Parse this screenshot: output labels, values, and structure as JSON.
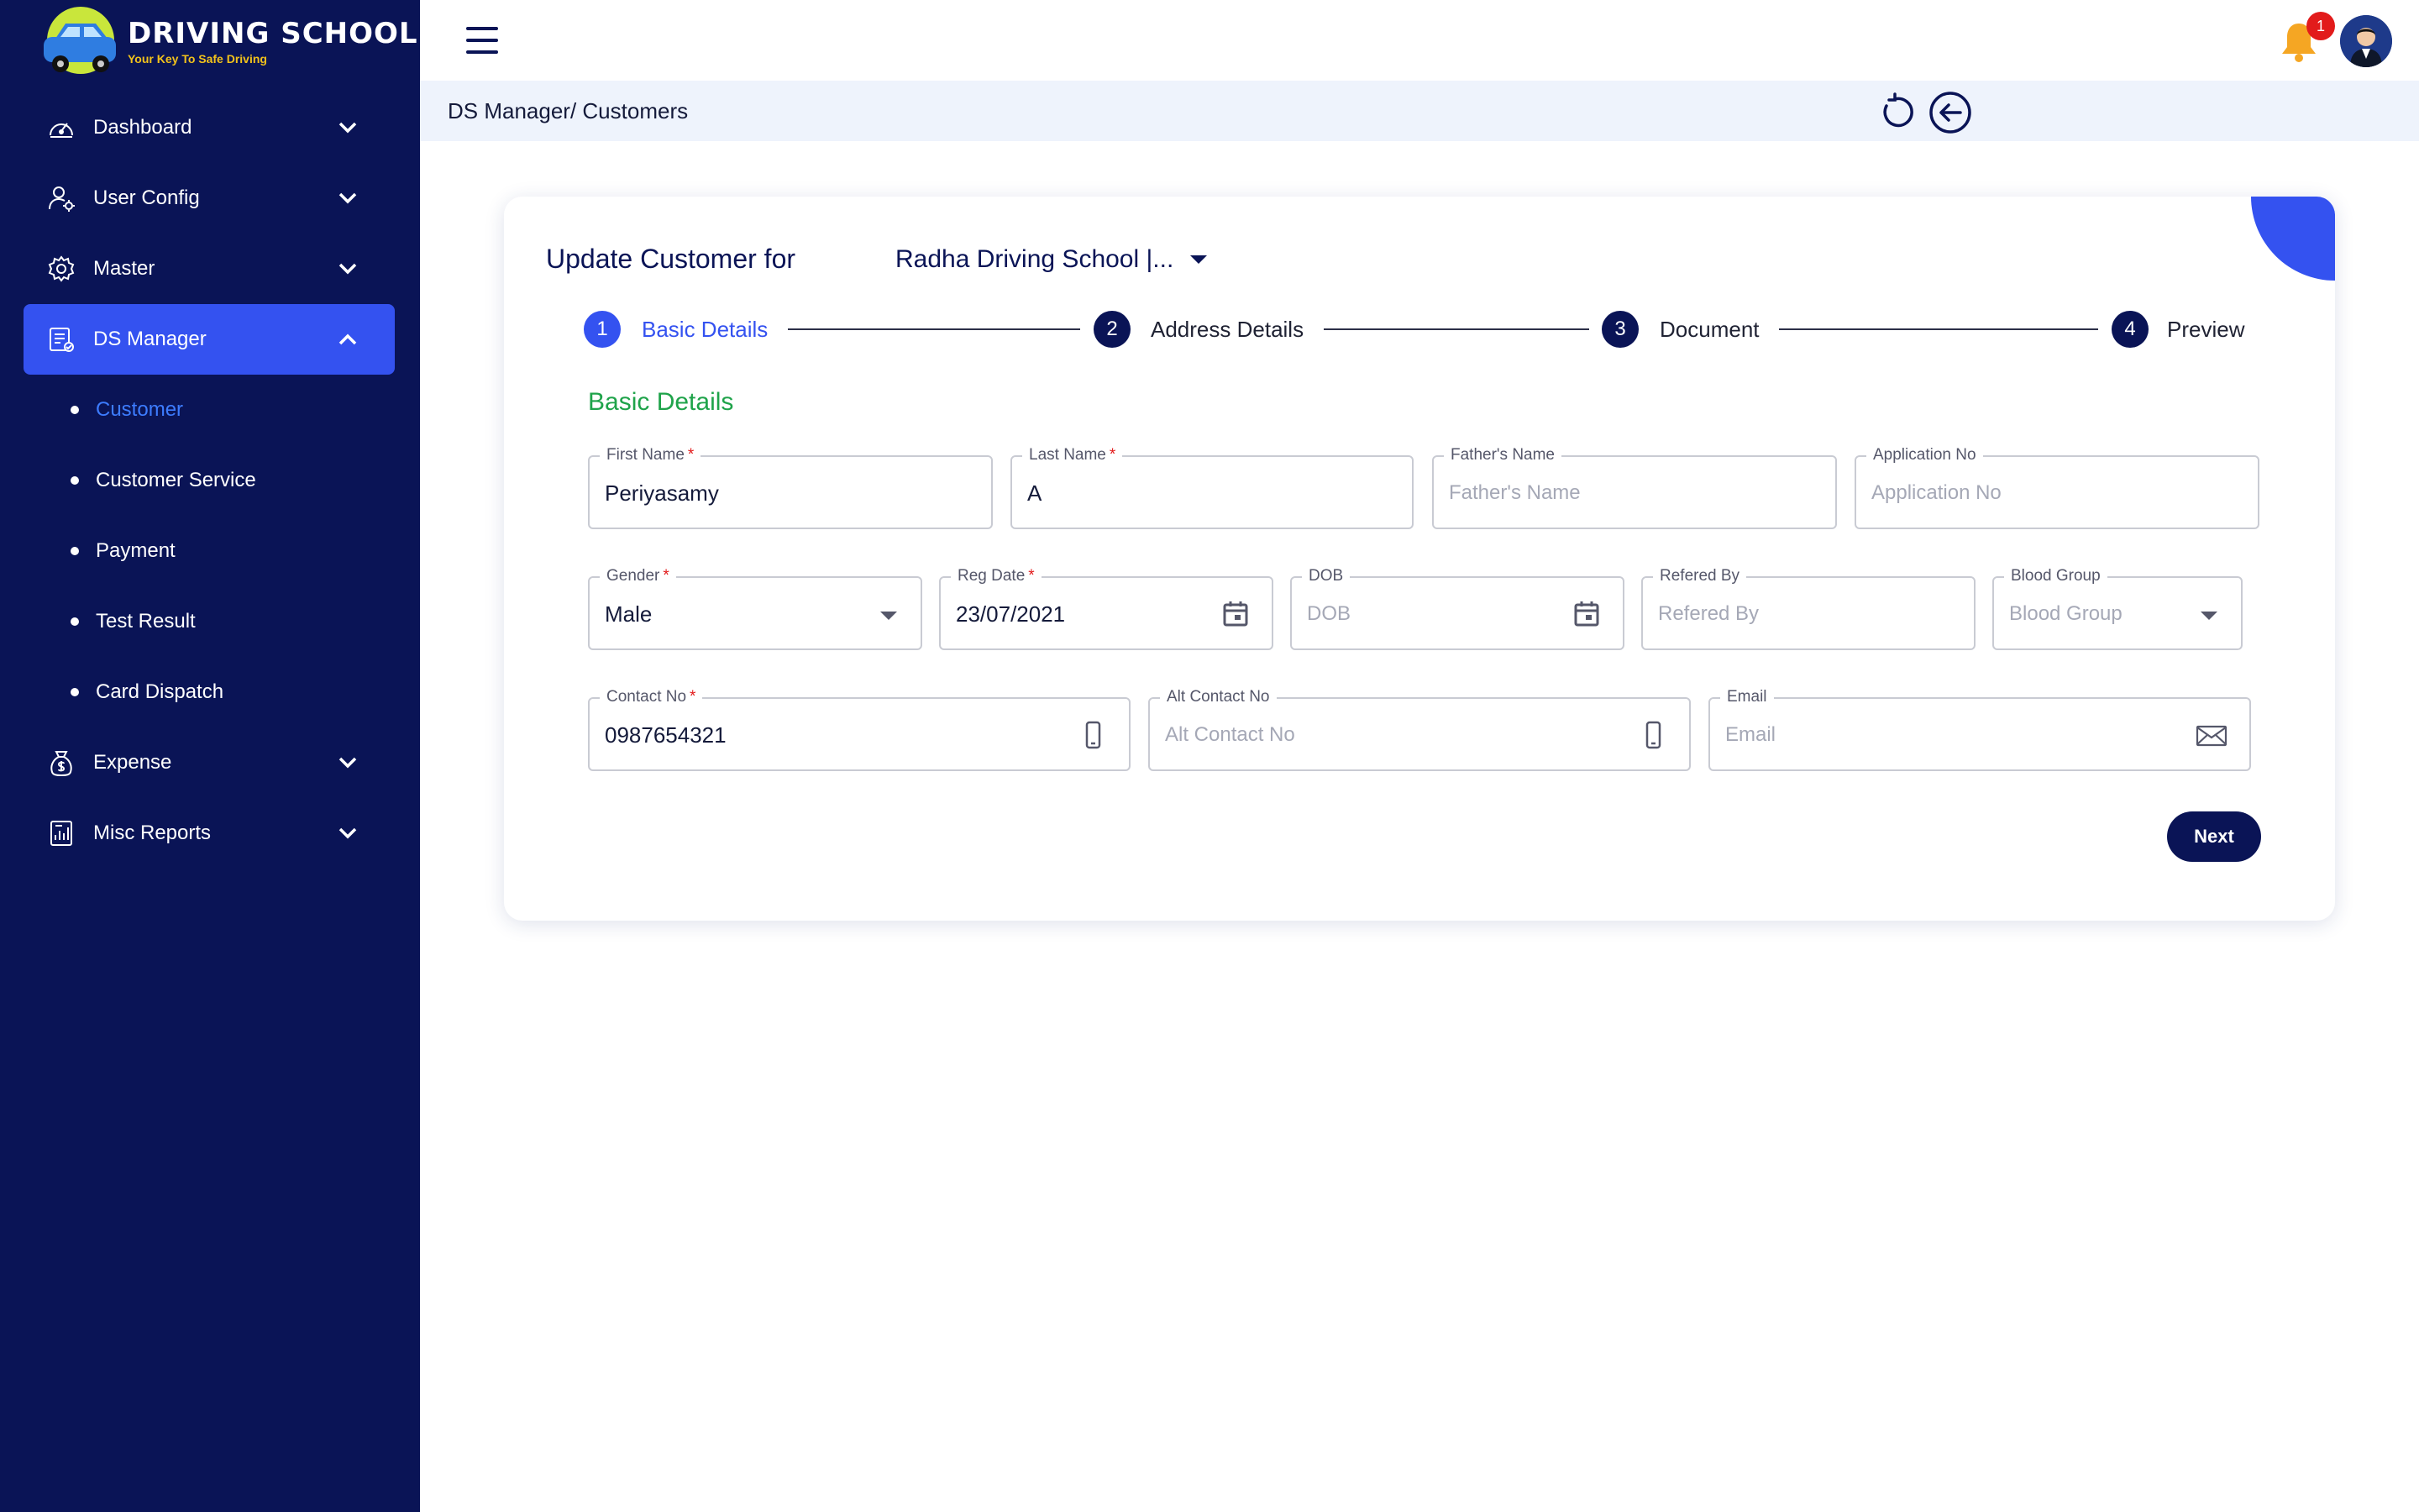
{
  "brand": {
    "title": "DRIVING SCHOOL",
    "tagline": "Your Key To Safe Driving"
  },
  "sidebar": {
    "items": [
      {
        "label": "Dashboard"
      },
      {
        "label": "User Config"
      },
      {
        "label": "Master"
      },
      {
        "label": "DS Manager"
      },
      {
        "label": "Expense"
      },
      {
        "label": "Misc Reports"
      }
    ],
    "sub_items": [
      {
        "label": "Customer"
      },
      {
        "label": "Customer Service"
      },
      {
        "label": "Payment"
      },
      {
        "label": "Test Result"
      },
      {
        "label": "Card Dispatch"
      }
    ]
  },
  "topbar": {
    "notification_count": "1"
  },
  "breadcrumb": "DS Manager/ Customers",
  "card": {
    "title": "Update Customer for",
    "school_selected": "Radha Driving School |...",
    "steps": [
      {
        "num": "1",
        "label": "Basic Details"
      },
      {
        "num": "2",
        "label": "Address Details"
      },
      {
        "num": "3",
        "label": "Document"
      },
      {
        "num": "4",
        "label": "Preview"
      }
    ],
    "section_title": "Basic Details",
    "next_label": "Next"
  },
  "form": {
    "first_name": {
      "label": "First Name",
      "value": "Periyasamy"
    },
    "last_name": {
      "label": "Last Name",
      "value": "A"
    },
    "fathers_name": {
      "label": "Father's Name",
      "placeholder": "Father's Name"
    },
    "application_no": {
      "label": "Application No",
      "placeholder": "Application No"
    },
    "gender": {
      "label": "Gender",
      "value": "Male"
    },
    "reg_date": {
      "label": "Reg Date",
      "value": "23/07/2021"
    },
    "dob": {
      "label": "DOB",
      "placeholder": "DOB"
    },
    "refered_by": {
      "label": "Refered By",
      "placeholder": "Refered By"
    },
    "blood_group": {
      "label": "Blood Group",
      "placeholder": "Blood Group"
    },
    "contact_no": {
      "label": "Contact No",
      "value": "0987654321"
    },
    "alt_contact_no": {
      "label": "Alt Contact No",
      "placeholder": "Alt Contact No"
    },
    "email": {
      "label": "Email",
      "placeholder": "Email"
    }
  },
  "required_mark": "*",
  "colors": {
    "sidebar": "#0a1456",
    "accent": "#3452f0",
    "section": "#1fa34a",
    "required": "#e21b1b"
  }
}
